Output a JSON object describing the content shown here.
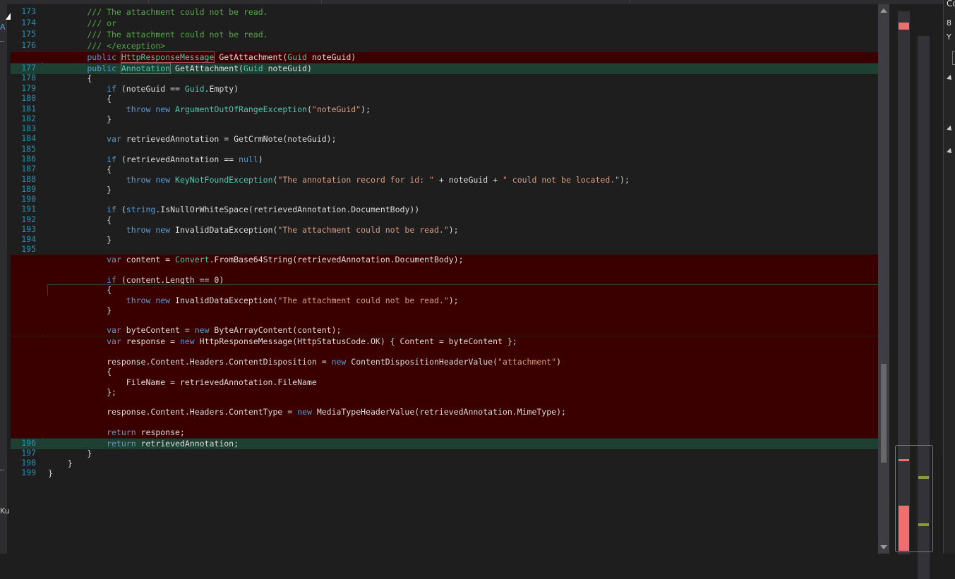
{
  "colors": {
    "background": "#1e1e1e",
    "deleted_line": "#3a0000",
    "added_line": "#1e4033",
    "keyword": "#569cd6",
    "type": "#4ec9b0",
    "string": "#d69d85",
    "comment": "#57a64a",
    "line_number": "#2b91af"
  },
  "left_strip": {
    "glyph_a": "A",
    "glyph_ku": "Ku"
  },
  "right_panel": {
    "c": "Co",
    "num": "8",
    "y": "Y"
  },
  "lines": [
    {
      "num": "173",
      "tokens": [
        [
          "cm",
          "        /// The attachment could not be read."
        ]
      ]
    },
    {
      "num": "174",
      "tokens": [
        [
          "cm",
          "        /// or"
        ]
      ]
    },
    {
      "num": "175",
      "tokens": [
        [
          "cm",
          "        /// The attachment could not be read."
        ]
      ]
    },
    {
      "num": "176",
      "tokens": [
        [
          "cm",
          "        /// </exception>"
        ]
      ]
    },
    {
      "num": "",
      "cls": "del",
      "tokens": [
        [
          "kw",
          "        public "
        ],
        [
          "box",
          "HttpResponseMessage"
        ],
        [
          "p",
          " GetAttachment("
        ],
        [
          "ty",
          "Guid"
        ],
        [
          "p",
          " noteGuid)"
        ]
      ]
    },
    {
      "num": "177",
      "cls": "add",
      "tokens": [
        [
          "kw",
          "        public "
        ],
        [
          "boxg",
          "Annotation"
        ],
        [
          "p",
          " GetAttachment("
        ],
        [
          "ty",
          "Guid"
        ],
        [
          "p",
          " noteGuid)"
        ]
      ]
    },
    {
      "num": "178",
      "tokens": [
        [
          "p",
          "        {"
        ]
      ]
    },
    {
      "num": "179",
      "tokens": [
        [
          "kw",
          "            if"
        ],
        [
          "p",
          " (noteGuid == "
        ],
        [
          "ty",
          "Guid"
        ],
        [
          "p",
          ".Empty)"
        ]
      ]
    },
    {
      "num": "180",
      "tokens": [
        [
          "p",
          "            {"
        ]
      ]
    },
    {
      "num": "181",
      "tokens": [
        [
          "kw",
          "                throw new "
        ],
        [
          "ty",
          "ArgumentOutOfRangeException"
        ],
        [
          "p",
          "("
        ],
        [
          "st",
          "\"noteGuid\""
        ],
        [
          "p",
          ");"
        ]
      ]
    },
    {
      "num": "182",
      "tokens": [
        [
          "p",
          "            }"
        ]
      ]
    },
    {
      "num": "183",
      "tokens": [
        [
          "p",
          ""
        ]
      ]
    },
    {
      "num": "184",
      "tokens": [
        [
          "kw",
          "            var"
        ],
        [
          "p",
          " retrievedAnnotation = GetCrmNote(noteGuid);"
        ]
      ]
    },
    {
      "num": "185",
      "tokens": [
        [
          "p",
          ""
        ]
      ]
    },
    {
      "num": "186",
      "tokens": [
        [
          "kw",
          "            if"
        ],
        [
          "p",
          " (retrievedAnnotation == "
        ],
        [
          "kw",
          "null"
        ],
        [
          "p",
          ")"
        ]
      ]
    },
    {
      "num": "187",
      "tokens": [
        [
          "p",
          "            {"
        ]
      ]
    },
    {
      "num": "188",
      "tokens": [
        [
          "kw",
          "                throw new "
        ],
        [
          "ty",
          "KeyNotFoundException"
        ],
        [
          "p",
          "("
        ],
        [
          "st",
          "\"The annotation record for id: \""
        ],
        [
          "p",
          " + noteGuid + "
        ],
        [
          "st",
          "\" could not be located.\""
        ],
        [
          "p",
          ");"
        ]
      ]
    },
    {
      "num": "189",
      "tokens": [
        [
          "p",
          "            }"
        ]
      ]
    },
    {
      "num": "190",
      "tokens": [
        [
          "p",
          ""
        ]
      ]
    },
    {
      "num": "191",
      "tokens": [
        [
          "kw",
          "            if"
        ],
        [
          "p",
          " ("
        ],
        [
          "kw",
          "string"
        ],
        [
          "p",
          ".IsNullOrWhiteSpace(retrievedAnnotation.DocumentBody))"
        ]
      ]
    },
    {
      "num": "192",
      "tokens": [
        [
          "p",
          "            {"
        ]
      ]
    },
    {
      "num": "193",
      "tokens": [
        [
          "kw",
          "                throw new "
        ],
        [
          "p",
          "InvalidDataException("
        ],
        [
          "st",
          "\"The attachment could not be read.\""
        ],
        [
          "p",
          ");"
        ]
      ]
    },
    {
      "num": "194",
      "tokens": [
        [
          "p",
          "            }"
        ]
      ]
    },
    {
      "num": "195",
      "tokens": [
        [
          "p",
          ""
        ]
      ]
    },
    {
      "num": "",
      "cls": "del",
      "tokens": [
        [
          "kw",
          "            var"
        ],
        [
          "p",
          " content = "
        ],
        [
          "ty",
          "Convert"
        ],
        [
          "p",
          ".FromBase64String(retrievedAnnotation.DocumentBody);"
        ]
      ]
    },
    {
      "num": "",
      "cls": "del",
      "tokens": [
        [
          "p",
          ""
        ]
      ]
    },
    {
      "num": "",
      "cls": "del",
      "tokens": [
        [
          "kw",
          "            if"
        ],
        [
          "p",
          " (content.Length == 0)"
        ]
      ]
    },
    {
      "num": "",
      "cls": "del cur",
      "tokens": [
        [
          "p",
          "            {"
        ]
      ]
    },
    {
      "num": "",
      "cls": "del",
      "tokens": [
        [
          "kw",
          "                throw new "
        ],
        [
          "p",
          "InvalidDataException("
        ],
        [
          "st",
          "\"The attachment could not be read.\""
        ],
        [
          "p",
          ");"
        ]
      ]
    },
    {
      "num": "",
      "cls": "del",
      "tokens": [
        [
          "p",
          "            }"
        ]
      ]
    },
    {
      "num": "",
      "cls": "del",
      "tokens": [
        [
          "p",
          ""
        ]
      ]
    },
    {
      "num": "",
      "cls": "del",
      "tokens": [
        [
          "kw",
          "            var"
        ],
        [
          "p",
          " byteContent = "
        ],
        [
          "kw",
          "new "
        ],
        [
          "p",
          "ByteArrayContent(content);"
        ]
      ]
    },
    {
      "num": "",
      "cls": "del",
      "tokens": [
        [
          "kw",
          "            var"
        ],
        [
          "p",
          " response = "
        ],
        [
          "kw",
          "new "
        ],
        [
          "p",
          "HttpResponseMessage(HttpStatusCode.OK) { Content = byteContent };"
        ]
      ]
    },
    {
      "num": "",
      "cls": "del",
      "tokens": [
        [
          "p",
          ""
        ]
      ]
    },
    {
      "num": "",
      "cls": "del",
      "tokens": [
        [
          "p",
          "            response.Content.Headers.ContentDisposition = "
        ],
        [
          "kw",
          "new "
        ],
        [
          "p",
          "ContentDispositionHeaderValue("
        ],
        [
          "st",
          "\"attachment\""
        ],
        [
          "p",
          ")"
        ]
      ]
    },
    {
      "num": "",
      "cls": "del",
      "tokens": [
        [
          "p",
          "            {"
        ]
      ]
    },
    {
      "num": "",
      "cls": "del",
      "tokens": [
        [
          "p",
          "                FileName = retrievedAnnotation.FileName"
        ]
      ]
    },
    {
      "num": "",
      "cls": "del",
      "tokens": [
        [
          "p",
          "            };"
        ]
      ]
    },
    {
      "num": "",
      "cls": "del",
      "tokens": [
        [
          "p",
          ""
        ]
      ]
    },
    {
      "num": "",
      "cls": "del",
      "tokens": [
        [
          "p",
          "            response.Content.Headers.ContentType = "
        ],
        [
          "kw",
          "new "
        ],
        [
          "p",
          "MediaTypeHeaderValue(retrievedAnnotation.MimeType);"
        ]
      ]
    },
    {
      "num": "",
      "cls": "del",
      "tokens": [
        [
          "p",
          ""
        ]
      ]
    },
    {
      "num": "",
      "cls": "del",
      "tokens": [
        [
          "kw",
          "            return"
        ],
        [
          "p",
          " response;"
        ]
      ]
    },
    {
      "num": "196",
      "cls": "add",
      "tokens": [
        [
          "kw",
          "            return"
        ],
        [
          "p",
          " retrievedAnnotation;"
        ]
      ]
    },
    {
      "num": "197",
      "tokens": [
        [
          "p",
          "        }"
        ]
      ]
    },
    {
      "num": "198",
      "tokens": [
        [
          "p",
          "    }"
        ]
      ]
    },
    {
      "num": "199",
      "tokens": [
        [
          "p",
          "}"
        ]
      ]
    }
  ]
}
